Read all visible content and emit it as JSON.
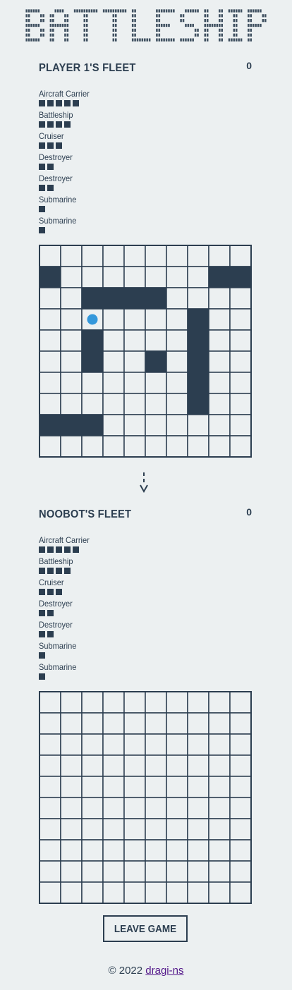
{
  "app": {
    "logo_text": "BATTLESHIP"
  },
  "player_fleet": {
    "title": "PLAYER 1'S FLEET",
    "score": "0",
    "ships": [
      {
        "name": "Aircraft Carrier",
        "size": 5
      },
      {
        "name": "Battleship",
        "size": 4
      },
      {
        "name": "Cruiser",
        "size": 3
      },
      {
        "name": "Destroyer",
        "size": 2
      },
      {
        "name": "Destroyer",
        "size": 2
      },
      {
        "name": "Submarine",
        "size": 1
      },
      {
        "name": "Submarine",
        "size": 1
      }
    ],
    "board": {
      "rows": 10,
      "cols": 10,
      "ship_cells": [
        [
          1,
          0
        ],
        [
          1,
          8
        ],
        [
          1,
          9
        ],
        [
          2,
          2
        ],
        [
          2,
          3
        ],
        [
          2,
          4
        ],
        [
          2,
          5
        ],
        [
          3,
          7
        ],
        [
          4,
          2
        ],
        [
          4,
          7
        ],
        [
          5,
          2
        ],
        [
          5,
          5
        ],
        [
          5,
          7
        ],
        [
          6,
          7
        ],
        [
          7,
          7
        ],
        [
          8,
          0
        ],
        [
          8,
          1
        ],
        [
          8,
          2
        ]
      ],
      "shot_markers": [
        [
          3,
          2
        ]
      ]
    }
  },
  "turn_indicator": {
    "icon": "down-arrow-icon"
  },
  "enemy_fleet": {
    "title": "NOOBOT'S FLEET",
    "score": "0",
    "ships": [
      {
        "name": "Aircraft Carrier",
        "size": 5
      },
      {
        "name": "Battleship",
        "size": 4
      },
      {
        "name": "Cruiser",
        "size": 3
      },
      {
        "name": "Destroyer",
        "size": 2
      },
      {
        "name": "Destroyer",
        "size": 2
      },
      {
        "name": "Submarine",
        "size": 1
      },
      {
        "name": "Submarine",
        "size": 1
      }
    ],
    "board": {
      "rows": 10,
      "cols": 10,
      "ship_cells": [],
      "shot_markers": []
    }
  },
  "actions": {
    "leave_label": "LEAVE GAME"
  },
  "footer": {
    "copyright": "© 2022 ",
    "author": "dragi-ns"
  },
  "colors": {
    "background": "#ecf0f1",
    "ink": "#2c3e50",
    "marker": "#3498db",
    "link": "#551a8b"
  }
}
